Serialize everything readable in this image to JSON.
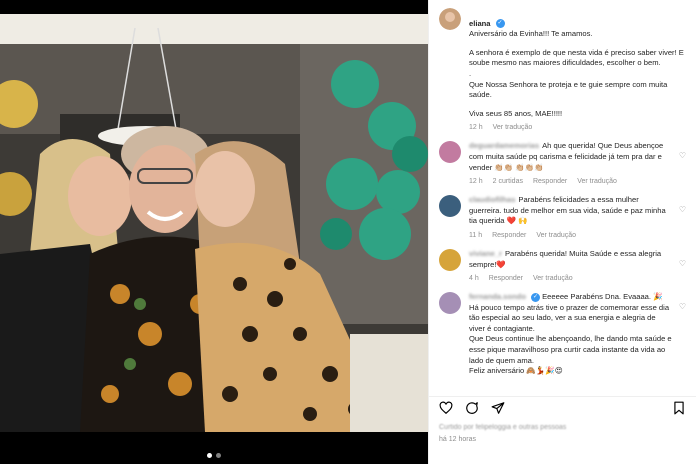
{
  "post": {
    "author": "eliana",
    "caption_lines": [
      "Aniversário da Evinha!!! Te amamos.",
      "A senhora é exemplo de que nesta vida é preciso saber viver! E soube mesmo nas maiores dificuldades, escolher o bem.",
      ".",
      "Que Nossa Senhora te proteja e te guie sempre com muita saúde.",
      "Viva seus 85 anos, MAE!!!!!"
    ],
    "caption_age": "12 h",
    "caption_translate": "Ver tradução",
    "time_ago": "há 12 horas",
    "liked_by_blurred": "Curtido por felipeloggia e outras pessoas"
  },
  "comments": [
    {
      "username": "deguardamemorias",
      "text": "Ah que querida! Que Deus abençoe com muita saúde pq carisma e felicidade já tem pra dar e vender 👏🏼👏🏼 👏🏼👏🏼👏🏼",
      "age": "12 h",
      "likes": "2 curtidas",
      "reply": "Responder",
      "translate": "Ver tradução",
      "avatar_color": "#c27ba0"
    },
    {
      "username": "claudiofilhas",
      "text": "Parabéns felicidades a essa mulher guerreira. tudo de melhor em sua vida, saúde e paz minha tia querida ❤️ 🙌",
      "age": "11 h",
      "likes": "",
      "reply": "Responder",
      "translate": "Ver tradução",
      "avatar_color": "#3b5f7d"
    },
    {
      "username": "viviane_r",
      "text": "Parabéns querida! Muita Saúde e essa alegria sempre!❤️",
      "age": "4 h",
      "likes": "",
      "reply": "Responder",
      "translate": "Ver tradução",
      "avatar_color": "#d6a43a"
    },
    {
      "username": "fernanda.sondo",
      "text": "Eeeeee Parabéns Dna. Evaaaa. 🎉\nHá pouco tempo atrás tive o prazer de comemorar esse dia tão especial ao seu lado, ver a sua energia e alegria de viver é contagiante.\nQue Deus continue lhe abençoando, lhe dando mta saúde e esse pique maravilhoso pra curtir cada instante da vida ao lado de quem ama.\nFeliz aniversário 🙈💃🎉😍",
      "age": "",
      "likes": "",
      "reply": "",
      "translate": "",
      "avatar_color": "#a58fb5"
    }
  ],
  "colors": {
    "accent_blue": "#3897f0",
    "heart_red": "#ed4956",
    "muted": "#8e8e8e"
  },
  "icons": [
    "heart-icon",
    "comment-icon",
    "share-icon",
    "bookmark-icon",
    "verified-icon"
  ]
}
